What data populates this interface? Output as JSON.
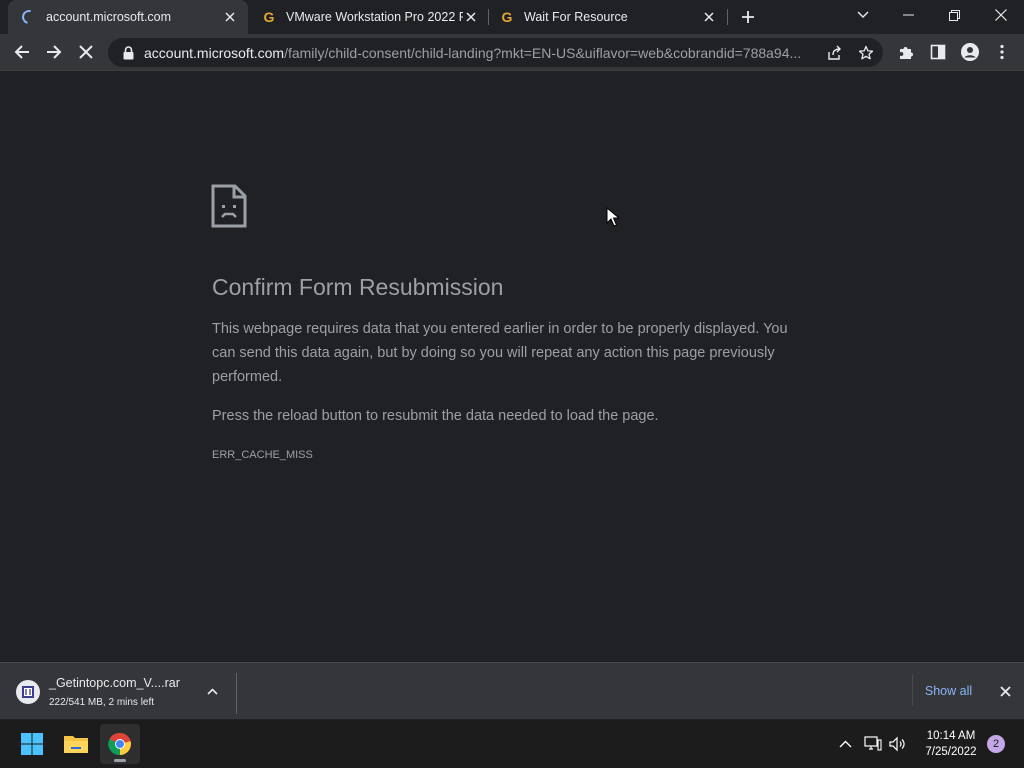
{
  "tabs": [
    {
      "title": "account.microsoft.com",
      "favicon": "loading-spinner",
      "active": true
    },
    {
      "title": "VMware Workstation Pro 2022 Fr",
      "favicon": "g-favicon",
      "active": false
    },
    {
      "title": "Wait For Resource",
      "favicon": "g-favicon",
      "active": false
    }
  ],
  "address_bar": {
    "host": "account.microsoft.com",
    "path": "/family/child-consent/child-landing?mkt=EN-US&uiflavor=web&cobrandid=788a94..."
  },
  "page": {
    "heading": "Confirm Form Resubmission",
    "paragraph1": "This webpage requires data that you entered earlier in order to be properly displayed. You can send this data again, but by doing so you will repeat any action this page previously performed.",
    "paragraph2": "Press the reload button to resubmit the data needed to load the page.",
    "error_code": "ERR_CACHE_MISS"
  },
  "download": {
    "filename": "_Getintopc.com_V....rar",
    "status": "222/541 MB, 2 mins left",
    "show_all_label": "Show all"
  },
  "taskbar": {
    "time": "10:14 AM",
    "date": "7/25/2022",
    "notification_count": "2"
  },
  "colors": {
    "background": "#202124",
    "toolbar": "#35363a",
    "link": "#8ab4f8",
    "text_secondary": "#9aa0a6"
  }
}
